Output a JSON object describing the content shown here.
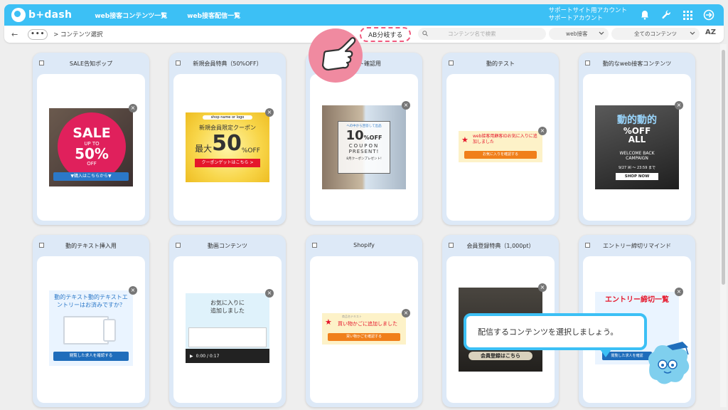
{
  "header": {
    "logo_text": "b+dash",
    "nav": [
      "web接客コンテンツ一覧",
      "web接客配信一覧"
    ],
    "account_line1": "サポートサイト用アカウント",
    "account_line2": "サポートアカウント"
  },
  "toolbar": {
    "back_symbol": "←",
    "dots": "•••",
    "breadcrumb": "> コンテンツ選択",
    "ab_button": "AB分岐する",
    "search_placeholder": "コンテンツ名で検索",
    "filter_type": "web接客",
    "filter_all": "全てのコンテンツ",
    "sort_label": "AZ"
  },
  "cards": [
    {
      "title": "SALE告知ポップ"
    },
    {
      "title": "新規会員特典（50%OFF）"
    },
    {
      "title": "テスト確認用"
    },
    {
      "title": "動的テスト"
    },
    {
      "title": "動的なweb接客コンテンツ"
    },
    {
      "title": "動的テキスト挿入用"
    },
    {
      "title": "動画コンテンツ"
    },
    {
      "title": "Shopify"
    },
    {
      "title": "会員登録特典（1,000pt）"
    },
    {
      "title": "エントリー締切リマインド"
    }
  ],
  "thumbs": {
    "sale_big": "SALE",
    "sale_upto": "UP TO",
    "sale_pct": "50%",
    "sale_off": "OFF",
    "sale_btn": "▼購入はこちらから▼",
    "member_shop": "shop name or logo",
    "member_title": "新規会員限定クーポン",
    "member_max": "最大",
    "member_num": "50",
    "member_off": "%OFF",
    "member_btn": "クーポンゲットはこちら >",
    "coupon_top": "ヘの中から回答して出品",
    "coupon_num": "10",
    "coupon_off": "%OFF",
    "coupon_word1": "COUPON",
    "coupon_word2": "PRESENT!",
    "coupon_bottom": "8月クーポンプレゼント!",
    "dyn_text": "web接客用顧客IDお気に入りに追加しました",
    "dyn_btn": "お気に入りを確認する",
    "dyn2_title1": "動的動的",
    "dyn2_title2": "%OFF",
    "dyn2_title3": "ALL",
    "dyn2_welcome": "WELCOME BACK",
    "dyn2_campaign": "CAMPAIGN",
    "dyn2_date": "9/27 ㈬ ～ 23:59 まで",
    "dyn2_btn": "SHOP NOW",
    "text_line1": "動的テキスト動的テキストエ",
    "text_line2": "ントリーはお済みですか？",
    "text_btn": "閲覧した求人を確認する",
    "video_line1": "お気に入りに",
    "video_line2": "追加しました",
    "video_time": "0:00 / 0:17",
    "shop_small": "商品名テキスト",
    "shop_text": "買い物かごに追加しました",
    "shop_btn": "買い物かごを確認する",
    "member2_btn": "会員登録はこちら",
    "entry_title": "エントリー締切一覧",
    "entry_btn": "閲覧した求人を確認"
  },
  "tooltip": "配信するコンテンツを選択しましょう。",
  "colors": {
    "brand": "#3cc0f5",
    "accent": "#f05a7e"
  }
}
